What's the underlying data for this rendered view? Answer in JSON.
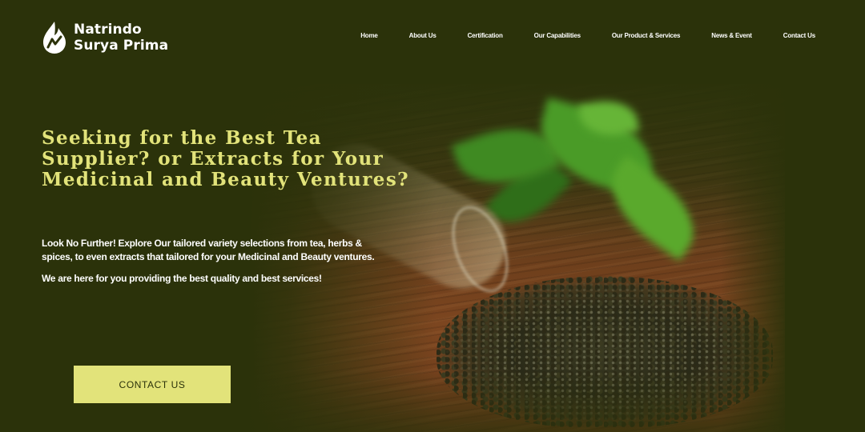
{
  "brand": {
    "name_line1": "Natrindo",
    "name_line2": "Surya Prima",
    "logo_icon": "flame-leaf-logo-icon"
  },
  "nav": {
    "items": [
      {
        "label": "Home"
      },
      {
        "label": "About Us"
      },
      {
        "label": "Certification"
      },
      {
        "label": "Our Capabilities"
      },
      {
        "label": "Our Product & Services"
      },
      {
        "label": "News & Event"
      },
      {
        "label": "Contact Us"
      }
    ]
  },
  "hero": {
    "headline": "Seeking for the Best Tea Supplier? or Extracts for Your Medicinal and Beauty Ventures?",
    "intro": "Look No Further! Explore Our tailored variety selections from tea, herbs & spices,  to even extracts that tailored for your Medicinal and Beauty ventures.",
    "tagline": "We are here for you providing the best quality and best services!",
    "cta_label": "CONTACT US"
  },
  "colors": {
    "background": "#2b320a",
    "accent": "#e2e37a",
    "text": "#ffffff"
  }
}
